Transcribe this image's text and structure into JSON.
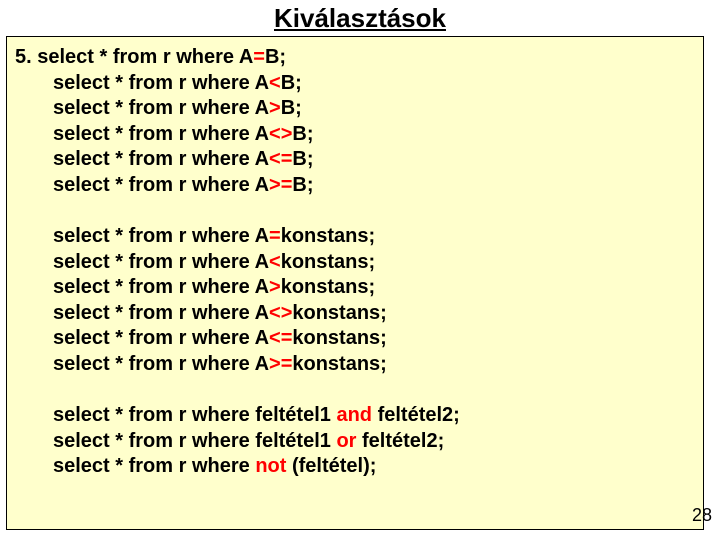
{
  "title": "Kiválasztások",
  "page_number": "28",
  "group1": {
    "prefix": "5. ",
    "lines": [
      {
        "pre": "select * from r where A",
        "op": "=",
        "post": "B;"
      },
      {
        "pre": "select * from r where A",
        "op": "<",
        "post": "B;"
      },
      {
        "pre": "select * from r where A",
        "op": ">",
        "post": "B;"
      },
      {
        "pre": "select * from r where A",
        "op": "<>",
        "post": "B;"
      },
      {
        "pre": "select * from r where A",
        "op": "<=",
        "post": "B;"
      },
      {
        "pre": "select * from r where A",
        "op": ">=",
        "post": "B;"
      }
    ]
  },
  "group2": {
    "lines": [
      {
        "pre": "select * from r where A",
        "op": "=",
        "post": "konstans;"
      },
      {
        "pre": "select * from r where A",
        "op": "<",
        "post": "konstans;"
      },
      {
        "pre": "select * from r where A",
        "op": ">",
        "post": "konstans;"
      },
      {
        "pre": "select * from r where A",
        "op": "<>",
        "post": "konstans;"
      },
      {
        "pre": "select * from r where A",
        "op": "<=",
        "post": "konstans;"
      },
      {
        "pre": "select * from r where A",
        "op": ">=",
        "post": "konstans;"
      }
    ]
  },
  "group3": {
    "lines": [
      {
        "pre": "select * from r where feltétel1 ",
        "kw": "and",
        "post": " feltétel2;"
      },
      {
        "pre": "select * from r where feltétel1 ",
        "kw": "or",
        "post": " feltétel2;"
      },
      {
        "pre": "select * from r where ",
        "kw": "not",
        "post": " (feltétel);"
      }
    ]
  }
}
